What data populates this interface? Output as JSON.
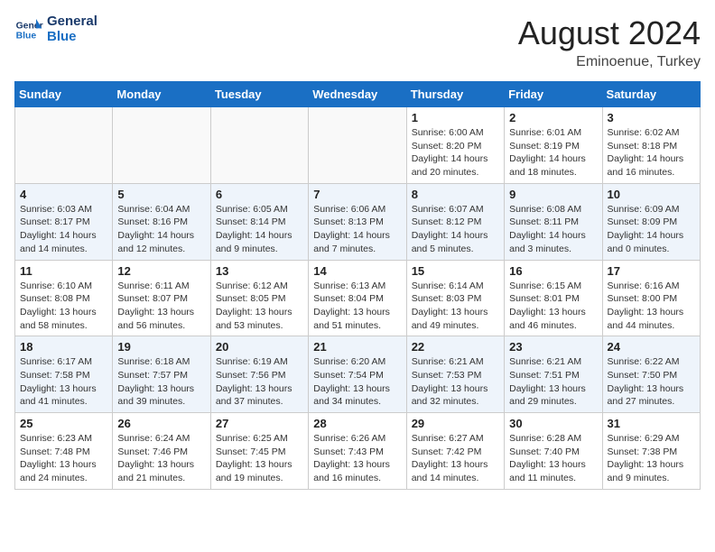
{
  "header": {
    "logo_line1": "General",
    "logo_line2": "Blue",
    "main_title": "August 2024",
    "subtitle": "Eminoenue, Turkey"
  },
  "days_of_week": [
    "Sunday",
    "Monday",
    "Tuesday",
    "Wednesday",
    "Thursday",
    "Friday",
    "Saturday"
  ],
  "weeks": [
    [
      {
        "day": "",
        "info": ""
      },
      {
        "day": "",
        "info": ""
      },
      {
        "day": "",
        "info": ""
      },
      {
        "day": "",
        "info": ""
      },
      {
        "day": "1",
        "info": "Sunrise: 6:00 AM\nSunset: 8:20 PM\nDaylight: 14 hours\nand 20 minutes."
      },
      {
        "day": "2",
        "info": "Sunrise: 6:01 AM\nSunset: 8:19 PM\nDaylight: 14 hours\nand 18 minutes."
      },
      {
        "day": "3",
        "info": "Sunrise: 6:02 AM\nSunset: 8:18 PM\nDaylight: 14 hours\nand 16 minutes."
      }
    ],
    [
      {
        "day": "4",
        "info": "Sunrise: 6:03 AM\nSunset: 8:17 PM\nDaylight: 14 hours\nand 14 minutes."
      },
      {
        "day": "5",
        "info": "Sunrise: 6:04 AM\nSunset: 8:16 PM\nDaylight: 14 hours\nand 12 minutes."
      },
      {
        "day": "6",
        "info": "Sunrise: 6:05 AM\nSunset: 8:14 PM\nDaylight: 14 hours\nand 9 minutes."
      },
      {
        "day": "7",
        "info": "Sunrise: 6:06 AM\nSunset: 8:13 PM\nDaylight: 14 hours\nand 7 minutes."
      },
      {
        "day": "8",
        "info": "Sunrise: 6:07 AM\nSunset: 8:12 PM\nDaylight: 14 hours\nand 5 minutes."
      },
      {
        "day": "9",
        "info": "Sunrise: 6:08 AM\nSunset: 8:11 PM\nDaylight: 14 hours\nand 3 minutes."
      },
      {
        "day": "10",
        "info": "Sunrise: 6:09 AM\nSunset: 8:09 PM\nDaylight: 14 hours\nand 0 minutes."
      }
    ],
    [
      {
        "day": "11",
        "info": "Sunrise: 6:10 AM\nSunset: 8:08 PM\nDaylight: 13 hours\nand 58 minutes."
      },
      {
        "day": "12",
        "info": "Sunrise: 6:11 AM\nSunset: 8:07 PM\nDaylight: 13 hours\nand 56 minutes."
      },
      {
        "day": "13",
        "info": "Sunrise: 6:12 AM\nSunset: 8:05 PM\nDaylight: 13 hours\nand 53 minutes."
      },
      {
        "day": "14",
        "info": "Sunrise: 6:13 AM\nSunset: 8:04 PM\nDaylight: 13 hours\nand 51 minutes."
      },
      {
        "day": "15",
        "info": "Sunrise: 6:14 AM\nSunset: 8:03 PM\nDaylight: 13 hours\nand 49 minutes."
      },
      {
        "day": "16",
        "info": "Sunrise: 6:15 AM\nSunset: 8:01 PM\nDaylight: 13 hours\nand 46 minutes."
      },
      {
        "day": "17",
        "info": "Sunrise: 6:16 AM\nSunset: 8:00 PM\nDaylight: 13 hours\nand 44 minutes."
      }
    ],
    [
      {
        "day": "18",
        "info": "Sunrise: 6:17 AM\nSunset: 7:58 PM\nDaylight: 13 hours\nand 41 minutes."
      },
      {
        "day": "19",
        "info": "Sunrise: 6:18 AM\nSunset: 7:57 PM\nDaylight: 13 hours\nand 39 minutes."
      },
      {
        "day": "20",
        "info": "Sunrise: 6:19 AM\nSunset: 7:56 PM\nDaylight: 13 hours\nand 37 minutes."
      },
      {
        "day": "21",
        "info": "Sunrise: 6:20 AM\nSunset: 7:54 PM\nDaylight: 13 hours\nand 34 minutes."
      },
      {
        "day": "22",
        "info": "Sunrise: 6:21 AM\nSunset: 7:53 PM\nDaylight: 13 hours\nand 32 minutes."
      },
      {
        "day": "23",
        "info": "Sunrise: 6:21 AM\nSunset: 7:51 PM\nDaylight: 13 hours\nand 29 minutes."
      },
      {
        "day": "24",
        "info": "Sunrise: 6:22 AM\nSunset: 7:50 PM\nDaylight: 13 hours\nand 27 minutes."
      }
    ],
    [
      {
        "day": "25",
        "info": "Sunrise: 6:23 AM\nSunset: 7:48 PM\nDaylight: 13 hours\nand 24 minutes."
      },
      {
        "day": "26",
        "info": "Sunrise: 6:24 AM\nSunset: 7:46 PM\nDaylight: 13 hours\nand 21 minutes."
      },
      {
        "day": "27",
        "info": "Sunrise: 6:25 AM\nSunset: 7:45 PM\nDaylight: 13 hours\nand 19 minutes."
      },
      {
        "day": "28",
        "info": "Sunrise: 6:26 AM\nSunset: 7:43 PM\nDaylight: 13 hours\nand 16 minutes."
      },
      {
        "day": "29",
        "info": "Sunrise: 6:27 AM\nSunset: 7:42 PM\nDaylight: 13 hours\nand 14 minutes."
      },
      {
        "day": "30",
        "info": "Sunrise: 6:28 AM\nSunset: 7:40 PM\nDaylight: 13 hours\nand 11 minutes."
      },
      {
        "day": "31",
        "info": "Sunrise: 6:29 AM\nSunset: 7:38 PM\nDaylight: 13 hours\nand 9 minutes."
      }
    ]
  ],
  "colors": {
    "header_bg": "#1a6fc4",
    "row_alt": "#eef4fb"
  }
}
